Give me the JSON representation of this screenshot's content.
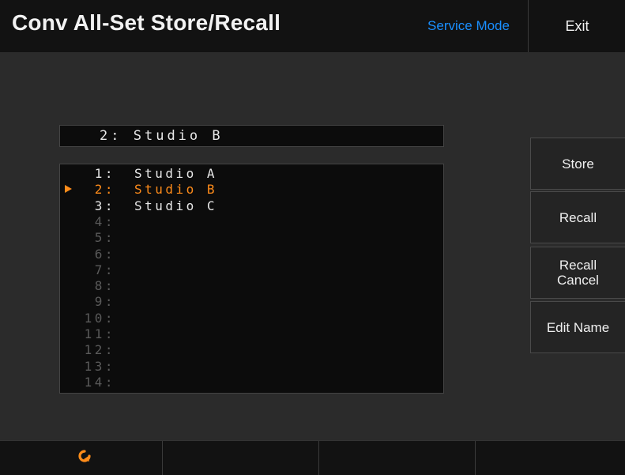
{
  "header": {
    "title": "Conv All-Set Store/Recall",
    "mode_label": "Service Mode",
    "exit_label": "Exit"
  },
  "current_name": {
    "number": "2:",
    "name": "Studio B"
  },
  "memory_list": {
    "selected_index": 2,
    "items": [
      {
        "number": "1:",
        "name": "Studio A"
      },
      {
        "number": "2:",
        "name": "Studio B"
      },
      {
        "number": "3:",
        "name": "Studio C"
      },
      {
        "number": "4:",
        "name": ""
      },
      {
        "number": "5:",
        "name": ""
      },
      {
        "number": "6:",
        "name": ""
      },
      {
        "number": "7:",
        "name": ""
      },
      {
        "number": "8:",
        "name": ""
      },
      {
        "number": "9:",
        "name": ""
      },
      {
        "number": "10:",
        "name": ""
      },
      {
        "number": "11:",
        "name": ""
      },
      {
        "number": "12:",
        "name": ""
      },
      {
        "number": "13:",
        "name": ""
      },
      {
        "number": "14:",
        "name": ""
      }
    ]
  },
  "side_buttons": {
    "store": "Store",
    "recall": "Recall",
    "recall_cancel_line1": "Recall",
    "recall_cancel_line2": "Cancel",
    "edit_name": "Edit Name"
  },
  "footer": {
    "refresh_icon": "refresh-icon"
  },
  "colors": {
    "accent_orange": "#ff8c1a",
    "mode_blue": "#1a8fff",
    "background": "#2b2b2b"
  }
}
